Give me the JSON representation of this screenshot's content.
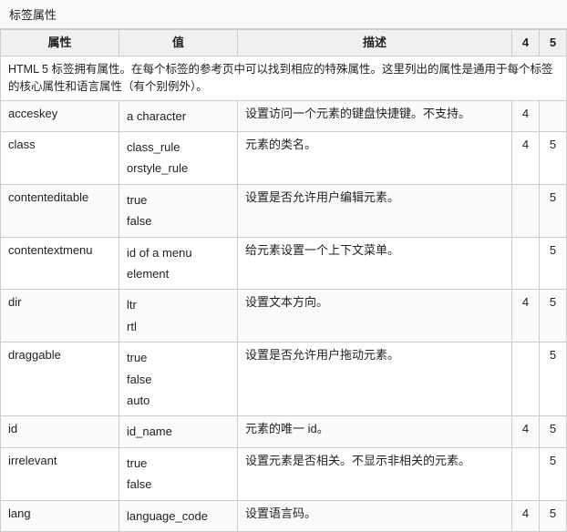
{
  "page": {
    "title": "标签属性"
  },
  "table": {
    "headers": [
      "属性",
      "值",
      "描述",
      "4",
      "5"
    ],
    "intro": "HTML 5 标签拥有属性。在每个标签的参考页中可以找到相应的特殊属性。这里列出的属性是通用于每个标签的核心属性和语言属性（有个别例外）。",
    "rows": [
      {
        "attr": "acceskey",
        "value": "a character",
        "desc": "设置访问一个元素的键盘快捷键。不支持。",
        "v4": "4",
        "v5": ""
      },
      {
        "attr": "class",
        "value": "class_rule\norstyle_rule",
        "desc": "元素的类名。",
        "v4": "4",
        "v5": "5"
      },
      {
        "attr": "contenteditable",
        "value": "true\nfalse",
        "desc": "设置是否允许用户编辑元素。",
        "v4": "",
        "v5": "5"
      },
      {
        "attr": "contentextmenu",
        "value": "id  of  a  menu\nelement",
        "desc": "给元素设置一个上下文菜单。",
        "v4": "",
        "v5": "5"
      },
      {
        "attr": "dir",
        "value": "ltr\nrtl",
        "desc": "设置文本方向。",
        "v4": "4",
        "v5": "5"
      },
      {
        "attr": "draggable",
        "value": "true\nfalse\nauto",
        "desc": "设置是否允许用户拖动元素。",
        "v4": "",
        "v5": "5"
      },
      {
        "attr": "id",
        "value": "id_name",
        "desc": "元素的唯一 id。",
        "v4": "4",
        "v5": "5"
      },
      {
        "attr": "irrelevant",
        "value": "true\nfalse",
        "desc": "设置元素是否相关。不显示非相关的元素。",
        "v4": "",
        "v5": "5"
      },
      {
        "attr": "lang",
        "value": "language_code",
        "desc": "设置语言码。",
        "v4": "4",
        "v5": "5"
      }
    ]
  }
}
